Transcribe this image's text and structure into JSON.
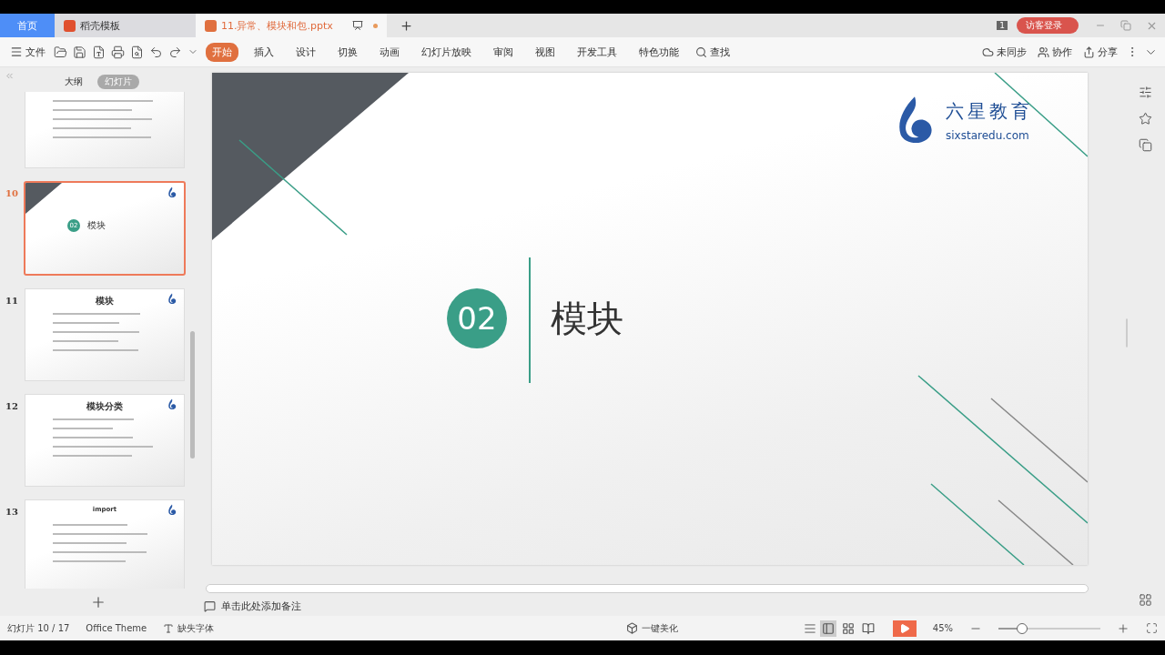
{
  "tabs": [
    {
      "label": "首页",
      "kind": "home",
      "selected": false
    },
    {
      "label": "稻壳模板",
      "kind": "docer",
      "selected": false
    },
    {
      "label": "11.异常、模块和包.pptx",
      "kind": "doc",
      "selected": true
    }
  ],
  "title_bar": {
    "badge": "1",
    "login": "访客登录"
  },
  "menu": {
    "file": "文件",
    "tabs": [
      {
        "label": "开始",
        "selected": true
      },
      {
        "label": "插入",
        "selected": false
      },
      {
        "label": "设计",
        "selected": false
      },
      {
        "label": "切换",
        "selected": false
      },
      {
        "label": "动画",
        "selected": false
      },
      {
        "label": "幻灯片放映",
        "selected": false
      },
      {
        "label": "审阅",
        "selected": false
      },
      {
        "label": "视图",
        "selected": false
      },
      {
        "label": "开发工具",
        "selected": false
      },
      {
        "label": "特色功能",
        "selected": false
      }
    ],
    "search": "查找",
    "sync": "未同步",
    "collab": "协作",
    "share": "分享"
  },
  "panel": {
    "tabs": [
      {
        "label": "大纲",
        "selected": false
      },
      {
        "label": "幻灯片",
        "selected": true
      }
    ],
    "slides": [
      {
        "kind": "text",
        "selected": false
      },
      {
        "number": "10",
        "kind": "section",
        "selected": true,
        "badge": "02",
        "title": "模块"
      },
      {
        "number": "11",
        "kind": "text",
        "selected": false,
        "title": "模块"
      },
      {
        "number": "12",
        "kind": "text",
        "selected": false,
        "title": "模块分类"
      },
      {
        "number": "13",
        "kind": "text",
        "selected": false,
        "title": "import"
      }
    ]
  },
  "slide": {
    "number": "02",
    "title": "模块",
    "logo": {
      "name": "六星教育",
      "url": "sixstaredu.com"
    }
  },
  "notes": {
    "placeholder": "单击此处添加备注"
  },
  "status_bar": {
    "slide": "幻灯片 10 / 17",
    "theme": "Office Theme",
    "fonts": "缺失字体",
    "beautify": "一键美化",
    "zoom": "45%",
    "zoom_slider": {
      "level": 0.2
    }
  }
}
